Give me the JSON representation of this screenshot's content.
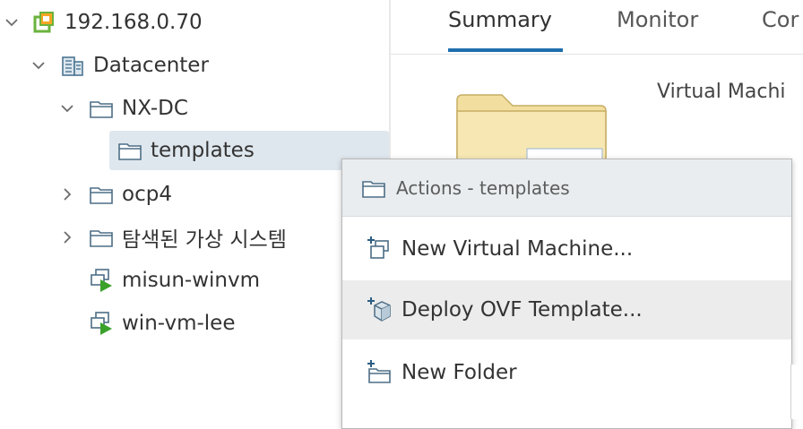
{
  "tree": {
    "items": [
      {
        "label": "192.168.0.70",
        "icon": "vcenter-icon"
      },
      {
        "label": "Datacenter",
        "icon": "datacenter-icon"
      },
      {
        "label": "NX-DC",
        "icon": "folder-icon"
      },
      {
        "label": "templates",
        "icon": "folder-icon"
      },
      {
        "label": "ocp4",
        "icon": "folder-icon"
      },
      {
        "label": "탐색된 가상 시스템",
        "icon": "folder-icon"
      },
      {
        "label": "misun-winvm",
        "icon": "vm-running-icon"
      },
      {
        "label": "win-vm-lee",
        "icon": "vm-running-icon"
      }
    ]
  },
  "tabs": [
    {
      "label": "Summary",
      "active": true
    },
    {
      "label": "Monitor",
      "active": false
    },
    {
      "label": "Cor",
      "active": false
    }
  ],
  "summary": {
    "heading": "Virtual Machi"
  },
  "context_menu": {
    "header": "Actions - templates",
    "items": [
      {
        "label": "New Virtual Machine...",
        "icon": "new-vm-icon"
      },
      {
        "label": "Deploy OVF Template...",
        "icon": "deploy-ovf-icon"
      },
      {
        "label": "New Folder",
        "icon": "new-folder-icon"
      }
    ]
  },
  "colors": {
    "accent": "#1f6fae",
    "selected_row": "#dfe7ee",
    "menu_header_bg": "#e9edf0",
    "menu_hover": "#ececec",
    "vm_run": "#3aa12b",
    "vcenter_green": "#6ab33c",
    "vcenter_orange": "#f5a623"
  }
}
